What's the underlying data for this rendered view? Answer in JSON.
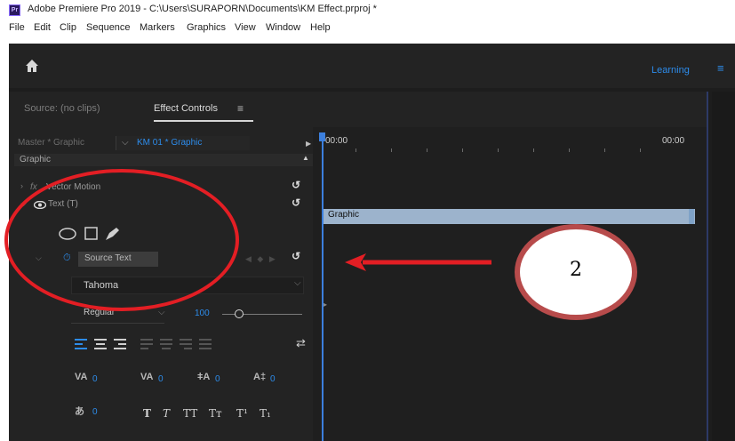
{
  "window": {
    "title": "Adobe Premiere Pro 2019 - C:\\Users\\SURAPORN\\Documents\\KM Effect.prproj *",
    "app_icon_text": "Pr"
  },
  "menu": [
    "File",
    "Edit",
    "Clip",
    "Sequence",
    "Markers",
    "Graphics",
    "View",
    "Window",
    "Help"
  ],
  "header": {
    "learning_label": "Learning"
  },
  "panel": {
    "source_tab": "Source: (no clips)",
    "effect_controls_tab": "Effect Controls",
    "master_label": "Master * Graphic",
    "clip_label": "KM 01 * Graphic",
    "graphic_header": "Graphic",
    "vector_motion": "Vector Motion",
    "text_layer": "Text (T)",
    "source_text": "Source Text",
    "font": "Tahoma",
    "font_style": "Regular",
    "font_size": "100",
    "tracking_values": [
      "0",
      "0",
      "0",
      "0",
      "0"
    ]
  },
  "timeline": {
    "start_time": "00:00",
    "end_time": "00:00",
    "clip_label": "Graphic"
  },
  "callout": {
    "number": "2"
  },
  "colors": {
    "accent_blue": "#2d8ceb",
    "annotation_red": "#e31e24",
    "callout_border": "#b74b4b",
    "clip_bar": "#9cb3cc"
  }
}
